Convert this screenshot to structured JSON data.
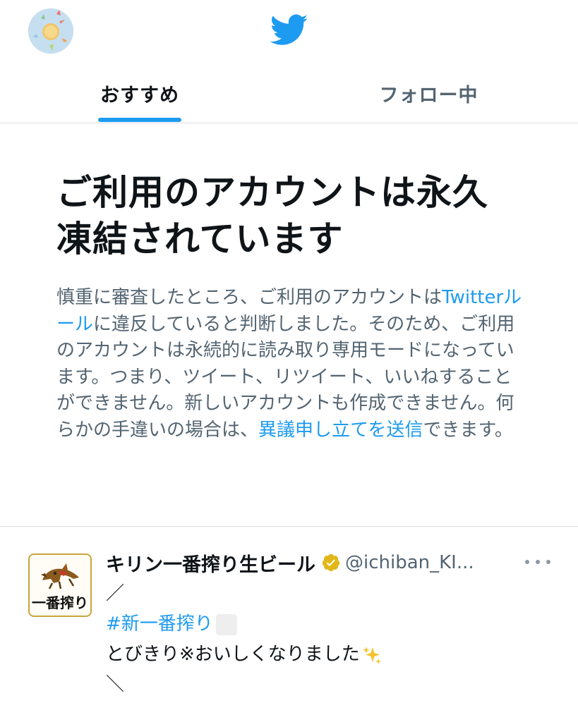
{
  "header": {
    "avatar_icon": "user-avatar-sun",
    "logo_icon": "twitter-bird-icon",
    "brand_color": "#1d9bf0"
  },
  "tabs": [
    {
      "label": "おすすめ",
      "active": true
    },
    {
      "label": "フォロー中",
      "active": false
    }
  ],
  "notice": {
    "title": "ご利用のアカウントは永久凍結されています",
    "body_prefix": "慎重に審査したところ、ご利用のアカウントは",
    "rules_link": "Twitterルール",
    "body_middle": "に違反していると判断しました。そのため、ご利用のアカウントは永続的に読み取り専用モードになっています。つまり、ツイート、リツイート、いいねすることができません。新しいアカウントも作成できません。何らかの手違いの場合は、",
    "appeal_link": "異議申し立てを送信",
    "body_suffix": "できます。"
  },
  "tweet": {
    "avatar_text": "一番搾り",
    "name": "キリン一番搾り生ビール",
    "verified_icon": "verified-badge-gold-icon",
    "handle": "@ichiban_KI...",
    "more_icon": "more-options-icon",
    "lines": [
      "／",
      "#新一番搾り",
      "とびきり※おいしくなりました",
      "＼"
    ],
    "sparkle_icon": "sparkles-emoji-icon",
    "hashtag_color": "#1d9bf0"
  }
}
